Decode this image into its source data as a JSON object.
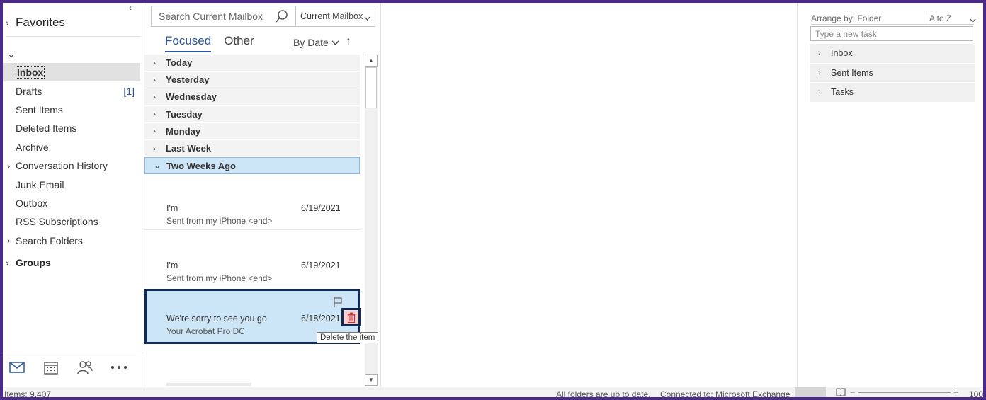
{
  "folder_pane": {
    "collapse_glyph": "‹",
    "favorites_label": "Favorites",
    "folders": [
      {
        "label": "Inbox",
        "count": ""
      },
      {
        "label": "Drafts",
        "count": "[1]"
      },
      {
        "label": "Sent Items",
        "count": ""
      },
      {
        "label": "Deleted Items",
        "count": ""
      },
      {
        "label": "Archive",
        "count": ""
      },
      {
        "label": "Conversation History",
        "count": ""
      },
      {
        "label": "Junk Email",
        "count": ""
      },
      {
        "label": "Outbox",
        "count": ""
      },
      {
        "label": "RSS Subscriptions",
        "count": ""
      },
      {
        "label": "Search Folders",
        "count": ""
      }
    ],
    "groups_label": "Groups",
    "nav_icons": [
      "mail-icon",
      "calendar-icon",
      "people-icon",
      "more-icon"
    ]
  },
  "message_list": {
    "search_placeholder": "Search Current Mailbox",
    "scope": "Current Mailbox",
    "tabs": {
      "focused": "Focused",
      "other": "Other"
    },
    "sort_label": "By Date",
    "groups": [
      "Today",
      "Yesterday",
      "Wednesday",
      "Tuesday",
      "Monday",
      "Last Week",
      "Two Weeks Ago"
    ],
    "messages": [
      {
        "subject": "I'm",
        "preview": "Sent from my iPhone <end>",
        "date": "6/19/2021"
      },
      {
        "subject": "I'm",
        "preview": "Sent from my iPhone <end>",
        "date": "6/19/2021"
      },
      {
        "subject": "We're sorry to see you go",
        "preview": "Your Acrobat Pro DC",
        "date": "6/18/2021"
      }
    ],
    "tooltip": "Delete the item"
  },
  "todo_pane": {
    "arrange_label": "Arrange by: Folder",
    "sort_label": "A to Z",
    "new_task_placeholder": "Type a new task",
    "groups": [
      "Inbox",
      "Sent Items",
      "Tasks"
    ]
  },
  "status_bar": {
    "items": "Items: 9,407",
    "sync": "All folders are up to date.",
    "connection": "Connected to: Microsoft Exchange",
    "zoom": "100"
  },
  "colors": {
    "accent": "#2b579a",
    "frame": "#4b2a8c",
    "selection": "#cde6f7",
    "highlight_border": "#0f2a5a"
  }
}
